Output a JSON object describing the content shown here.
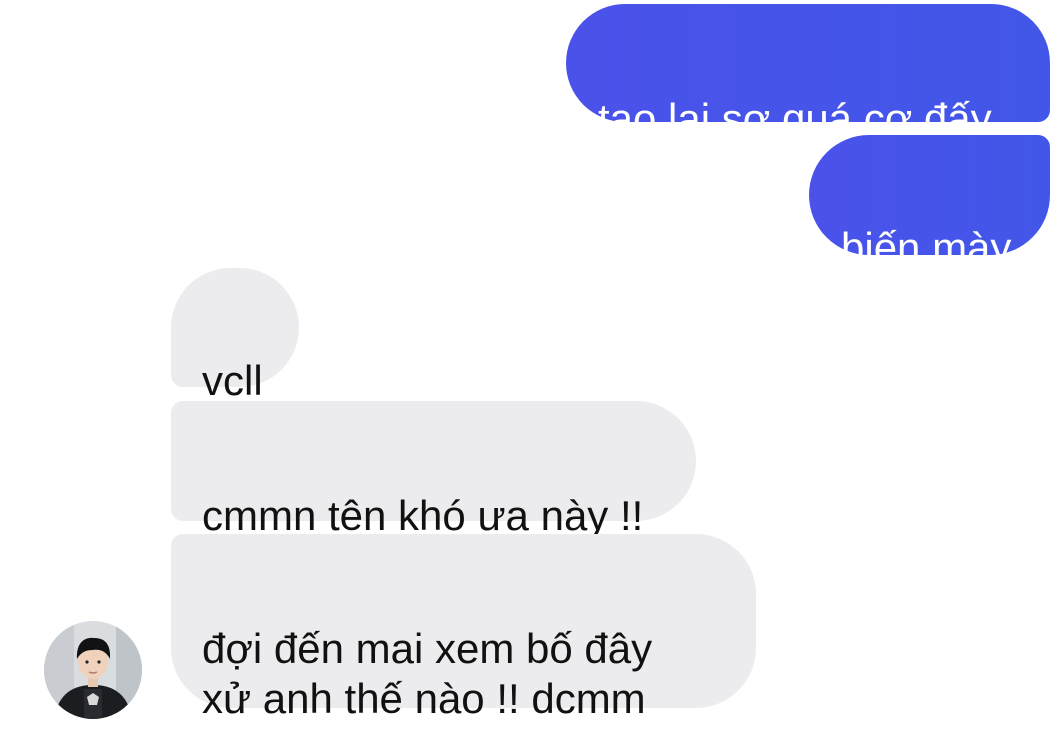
{
  "conversation": {
    "messages": [
      {
        "sender": "me",
        "text": "tao lại sợ quá cơ đấy"
      },
      {
        "sender": "me",
        "text": "biến mày"
      },
      {
        "sender": "other",
        "text": "vcll"
      },
      {
        "sender": "other",
        "text": "cmmn tên khó ưa này !!"
      },
      {
        "sender": "other",
        "text": "đợi đến mai xem bố đây\nxử anh thế nào !! dcmm"
      }
    ]
  },
  "colors": {
    "sent_bubble": "#4a52ea",
    "received_bubble": "#ececee",
    "sent_text": "#ffffff",
    "received_text": "#111111"
  },
  "icons": {
    "contact_avatar": "avatar-photo"
  }
}
